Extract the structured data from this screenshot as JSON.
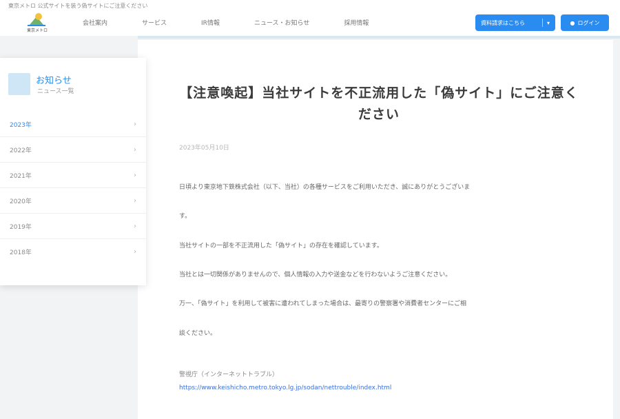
{
  "header": {
    "caption": "東京メトロ 公式サイトを装う偽サイトにご注意ください",
    "logo_text": "東京メトロ",
    "nav": [
      "会社案内",
      "サービス",
      "IR情報",
      "ニュース・お知らせ",
      "採用情報"
    ],
    "demo_button": "資料請求はこちら",
    "login_button": "ログイン"
  },
  "sidebar": {
    "title": "お知らせ",
    "subtitle": "ニュース一覧",
    "items": [
      {
        "label": "2023年",
        "active": true
      },
      {
        "label": "2022年",
        "active": false
      },
      {
        "label": "2021年",
        "active": false
      },
      {
        "label": "2020年",
        "active": false
      },
      {
        "label": "2019年",
        "active": false
      },
      {
        "label": "2018年",
        "active": false
      }
    ],
    "chevron": "›"
  },
  "article": {
    "title": "【注意喚起】当社サイトを不正流用した「偽サイト」にご注意ください",
    "date": "2023年05月10日",
    "paragraphs": [
      "日頃より東京地下鉄株式会社（以下、当社）の各種サービスをご利用いただき、誠にありがとうございま",
      "す。",
      "当社サイトの一部を不正流用した「偽サイト」の存在を確認しています。",
      "当社とは一切関係がありませんので、個人情報の入力や送金などを行わないようご注意ください。",
      "万一、「偽サイト」を利用して被害に遭われてしまった場合は、最寄りの警察署や消費者センターにご相",
      "談ください。"
    ],
    "reference": "警視庁（インターネットトラブル）",
    "link": "https://www.keishicho.metro.tokyo.lg.jp/sodan/nettrouble/index.html"
  },
  "colors": {
    "accent": "#2a8cf0",
    "link": "#3b6fdc"
  }
}
